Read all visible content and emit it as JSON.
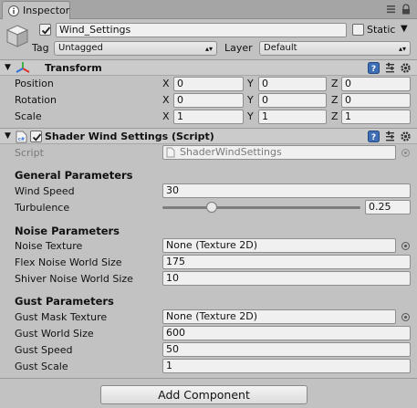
{
  "tab": {
    "title": "Inspector"
  },
  "gameobject": {
    "name": "Wind_Settings",
    "static_label": "Static",
    "tag_label": "Tag",
    "tag_value": "Untagged",
    "layer_label": "Layer",
    "layer_value": "Default"
  },
  "transform": {
    "title": "Transform",
    "rows": [
      {
        "label": "Position",
        "x": "0",
        "y": "0",
        "z": "0"
      },
      {
        "label": "Rotation",
        "x": "0",
        "y": "0",
        "z": "0"
      },
      {
        "label": "Scale",
        "x": "1",
        "y": "1",
        "z": "1"
      }
    ],
    "axis": {
      "x": "X",
      "y": "Y",
      "z": "Z"
    }
  },
  "script_component": {
    "title": "Shader Wind Settings (Script)",
    "script_label": "Script",
    "script_value": "ShaderWindSettings"
  },
  "general": {
    "heading": "General Parameters",
    "wind_speed_label": "Wind Speed",
    "wind_speed_value": "30",
    "turbulence_label": "Turbulence",
    "turbulence_value": "0.25",
    "turbulence_fraction": 0.25
  },
  "noise": {
    "heading": "Noise Parameters",
    "texture_label": "Noise Texture",
    "texture_value": "None (Texture 2D)",
    "flex_label": "Flex Noise World Size",
    "flex_value": "175",
    "shiver_label": "Shiver Noise World Size",
    "shiver_value": "10"
  },
  "gust": {
    "heading": "Gust Parameters",
    "mask_label": "Gust Mask Texture",
    "mask_value": "None (Texture 2D)",
    "world_size_label": "Gust World Size",
    "world_size_value": "600",
    "speed_label": "Gust Speed",
    "speed_value": "50",
    "scale_label": "Gust Scale",
    "scale_value": "1"
  },
  "add_component": "Add Component",
  "colors": {
    "transform_red": "#d9332b",
    "transform_green": "#3cb043",
    "transform_blue": "#2f6fd6",
    "help_blue": "#3e6fb6"
  }
}
